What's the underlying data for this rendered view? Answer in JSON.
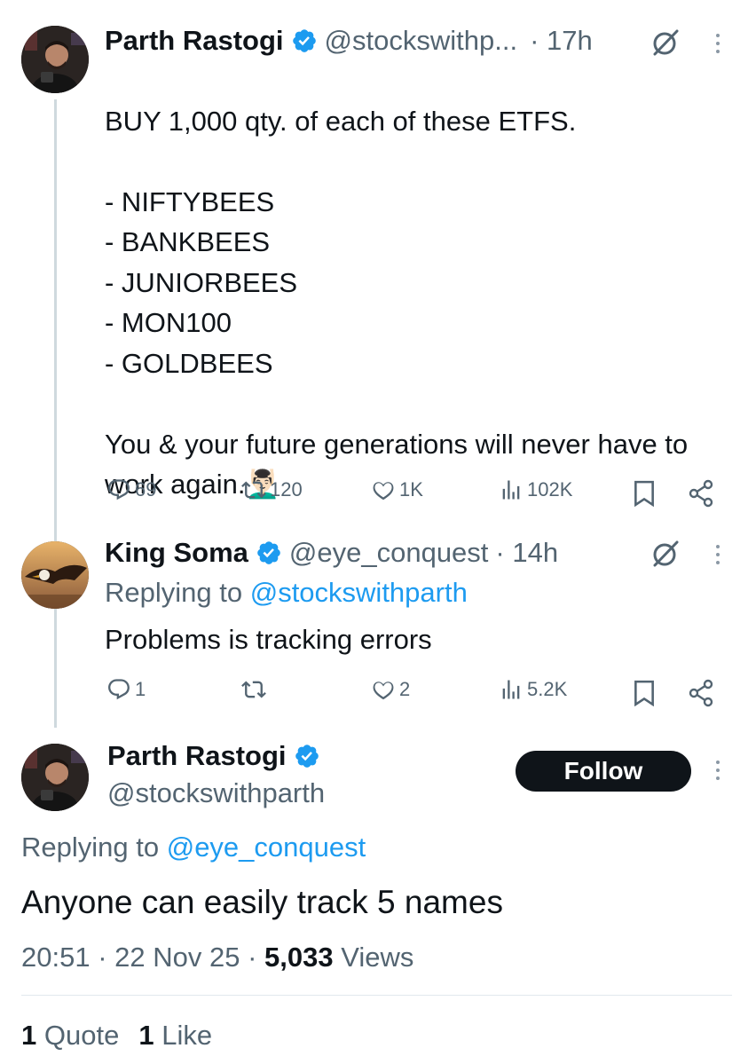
{
  "tweet1": {
    "name": "Parth Rastogi",
    "handle": "@stockswithp...",
    "time": "· 17h",
    "body": "BUY 1,000 qty. of each of these ETFS.\n\n- NIFTYBEES\n- BANKBEES\n- JUNIORBEES\n- MON100\n- GOLDBEES\n\nYou & your future generations will never have to work again.",
    "emoji": "💆🏻‍♂️",
    "actions": {
      "replies": "69",
      "retweets": "120",
      "likes": "1K",
      "views": "102K"
    }
  },
  "tweet2": {
    "name": "King Soma",
    "handle": "@eye_conquest",
    "time": "· 14h",
    "replying_prefix": "Replying to ",
    "replying_to": "@stockswithparth",
    "body": "Problems is tracking errors",
    "actions": {
      "replies": "1",
      "retweets": "",
      "likes": "2",
      "views": "5.2K"
    }
  },
  "main": {
    "name": "Parth Rastogi",
    "handle": "@stockswithparth",
    "follow_label": "Follow",
    "replying_prefix": "Replying to ",
    "replying_to": "@eye_conquest",
    "body": "Anyone can easily track 5 names",
    "time": "20:51",
    "date": "22 Nov 25",
    "views_count": "5,033",
    "views_label": "Views",
    "quotes_count": "1",
    "quotes_label": "Quote",
    "likes_count": "1",
    "likes_label": "Like"
  },
  "colors": {
    "accent": "#1d9bf0",
    "text": "#0f1419",
    "muted": "#536471",
    "verified": "#1d9bf0"
  }
}
